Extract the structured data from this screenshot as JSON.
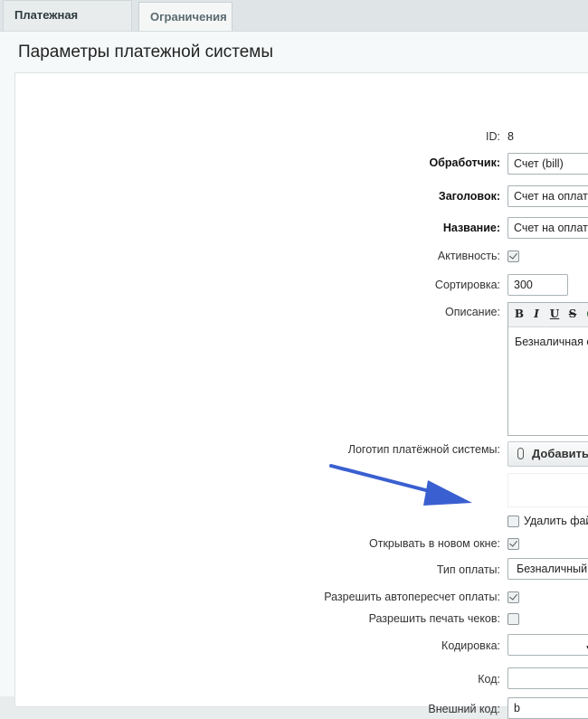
{
  "tabs": {
    "payment_system": "Платежная система",
    "restrictions": "Ограничения"
  },
  "page_title": "Параметры платежной системы",
  "fields": {
    "id": {
      "label": "ID:",
      "value": "8"
    },
    "handler": {
      "label": "Обработчик:",
      "value": "Счет (bill)"
    },
    "header": {
      "label": "Заголовок:",
      "value": "Счет на оплату"
    },
    "name": {
      "label": "Название:",
      "value": "Счет на оплату"
    },
    "active": {
      "label": "Активность:",
      "checked": true
    },
    "sort": {
      "label": "Сортировка:",
      "value": "300"
    },
    "description": {
      "label": "Описание:",
      "value": "Безналичная оплат"
    },
    "logo": {
      "label": "Логотип платёжной системы:",
      "button": "Добавить фай"
    },
    "delete_file": {
      "label": "Удалить файл",
      "checked": false
    },
    "new_window": {
      "label": "Открывать в новом окне:",
      "checked": true
    },
    "pay_type": {
      "label": "Тип оплаты:",
      "value": "Безналичный"
    },
    "auto_recalc": {
      "label": "Разрешить автопересчет оплаты:",
      "checked": true
    },
    "print_checks": {
      "label": "Разрешить печать чеков:",
      "checked": false
    },
    "encoding": {
      "label": "Кодировка:",
      "value": ""
    },
    "code": {
      "label": "Код:",
      "value": ""
    },
    "external_code": {
      "label": "Внешний код:",
      "value": "b"
    }
  },
  "editor_toolbar": {
    "bold": "B",
    "italic": "I",
    "underline": "U",
    "strike": "S"
  },
  "colors": {
    "arrow": "#3a5fd0",
    "accent_icon": "#3d9a54"
  }
}
